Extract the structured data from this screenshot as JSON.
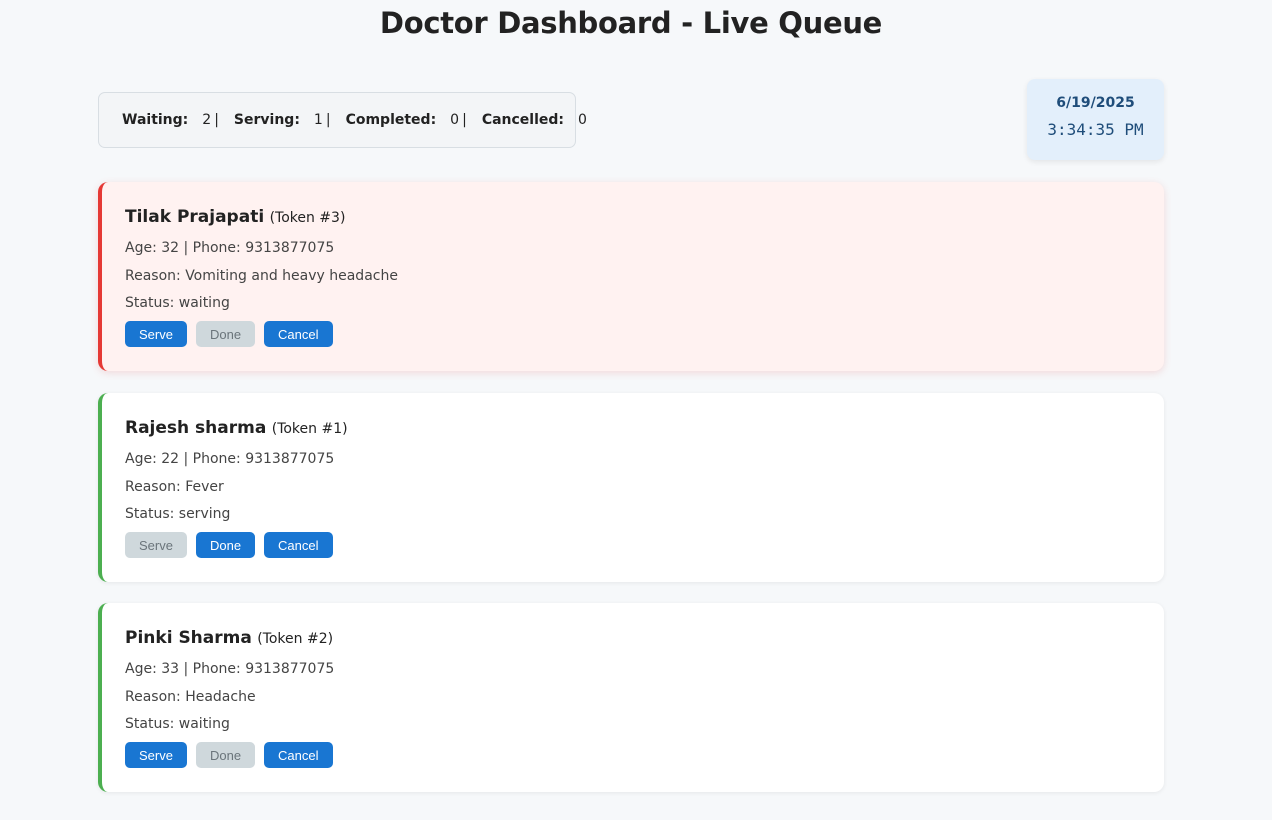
{
  "header": {
    "title": "Doctor Dashboard - Live Queue"
  },
  "stats": {
    "waiting_label": "Waiting:",
    "waiting_value": "2",
    "serving_label": "Serving:",
    "serving_value": "1",
    "completed_label": "Completed:",
    "completed_value": "0",
    "cancelled_label": "Cancelled:",
    "cancelled_value": "0",
    "separator": "|"
  },
  "clock": {
    "date": "6/19/2025",
    "time": "3:34:35 PM"
  },
  "buttons": {
    "serve": "Serve",
    "done": "Done",
    "cancel": "Cancel"
  },
  "colors": {
    "accent": "#1976d2",
    "alert_border": "#e53935",
    "normal_border": "#4caf50",
    "disabled": "#cfd8dc"
  },
  "patients": [
    {
      "name": "Tilak Prajapati",
      "token": "(Token #3)",
      "details": "Age: 32 | Phone: 9313877075",
      "reason": "Reason: Vomiting and heavy headache",
      "status": "Status: waiting",
      "serve_enabled": true,
      "done_enabled": false,
      "cancel_enabled": true
    },
    {
      "name": "Rajesh sharma",
      "token": "(Token #1)",
      "details": "Age: 22 | Phone: 9313877075",
      "reason": "Reason: Fever",
      "status": "Status: serving",
      "serve_enabled": false,
      "done_enabled": true,
      "cancel_enabled": true
    },
    {
      "name": "Pinki Sharma",
      "token": "(Token #2)",
      "details": "Age: 33 | Phone: 9313877075",
      "reason": "Reason: Headache",
      "status": "Status: waiting",
      "serve_enabled": true,
      "done_enabled": false,
      "cancel_enabled": true
    }
  ]
}
